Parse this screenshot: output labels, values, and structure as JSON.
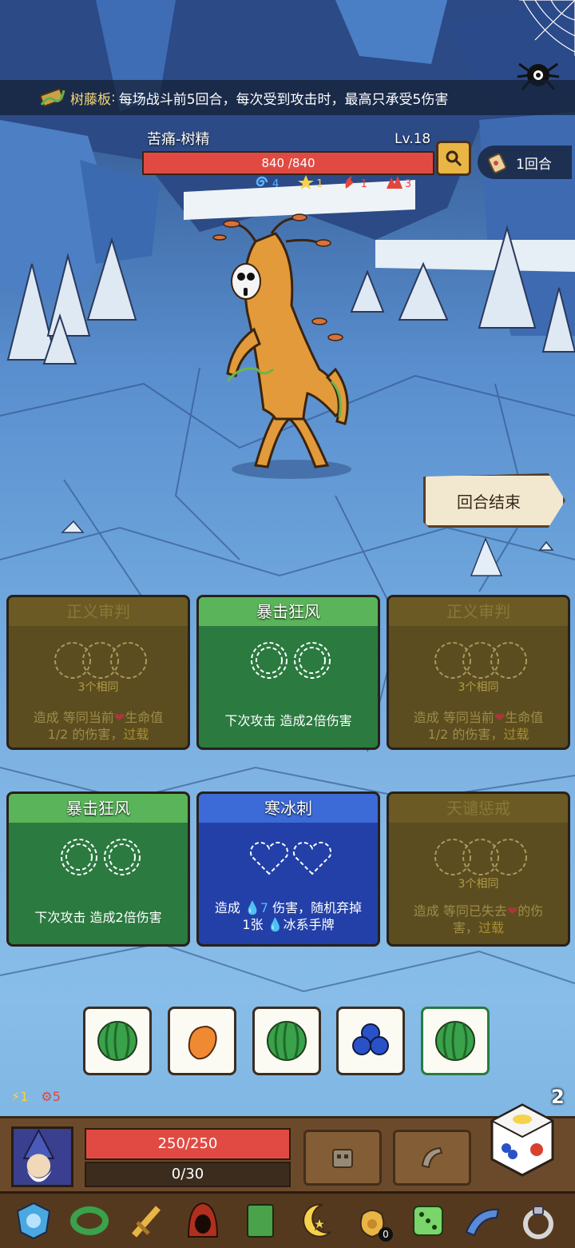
{
  "relic": {
    "name": "树藤板",
    "separator": ":",
    "description": "每场战斗前5回合，每次受到攻击时，最高只承受5伤害"
  },
  "enemy": {
    "name": "苦痛-树精",
    "level": "Lv.18",
    "hp_text": "840 /840",
    "hp_fraction": 1.0,
    "statuses": [
      {
        "icon": "spiral-icon",
        "value": "4",
        "color": "#58b6ff"
      },
      {
        "icon": "star-icon",
        "value": "1",
        "color": "#f6d24a"
      },
      {
        "icon": "claw-icon",
        "value": "1",
        "color": "#e2463b"
      },
      {
        "icon": "spike-icon",
        "value": "3",
        "color": "#e2463b"
      }
    ]
  },
  "turn": {
    "label": "1回合"
  },
  "end_turn": {
    "label": "回合结束"
  },
  "cards": [
    {
      "title": "正义审判",
      "style": "olive",
      "slots": 3,
      "slot_shape": "circle",
      "condition": "3个相同",
      "desc_a": "造成 等同当前",
      "desc_heart": "❤",
      "desc_b": "生命值",
      "desc_c": "1/2 的伤害，",
      "desc_kw": "过载"
    },
    {
      "title": "暴击狂风",
      "style": "green",
      "slots": 2,
      "slot_shape": "circle",
      "desc": "下次攻击 造成2倍伤害"
    },
    {
      "title": "正义审判",
      "style": "olive",
      "slots": 3,
      "slot_shape": "circle",
      "condition": "3个相同",
      "desc_a": "造成 等同当前",
      "desc_heart": "❤",
      "desc_b": "生命值",
      "desc_c": "1/2 的伤害，",
      "desc_kw": "过载"
    },
    {
      "title": "暴击狂风",
      "style": "green",
      "slots": 2,
      "slot_shape": "circle",
      "desc": "下次攻击 造成2倍伤害"
    },
    {
      "title": "寒冰刺",
      "style": "blue",
      "slots": 2,
      "slot_shape": "heart",
      "desc_a": "造成",
      "desc_drop": "💧7",
      "desc_b": "伤害，随机弃掉",
      "desc_c": "1张",
      "desc_drop2": "💧",
      "desc_d": "冰系手牌"
    },
    {
      "title": "天谴惩戒",
      "style": "olive",
      "slots": 3,
      "slot_shape": "circle",
      "condition": "3个相同",
      "desc_a": "造成 等同已失去",
      "desc_heart": "❤",
      "desc_b": "的伤",
      "desc_c": "害，",
      "desc_kw": "过载"
    }
  ],
  "dice": [
    {
      "face": "watermelon",
      "selected": false
    },
    {
      "face": "potato",
      "selected": false
    },
    {
      "face": "watermelon",
      "selected": false
    },
    {
      "face": "blueberry",
      "selected": false
    },
    {
      "face": "watermelon",
      "selected": true
    }
  ],
  "energy": {
    "lightning": "1",
    "gear": "5"
  },
  "player": {
    "hp_text": "250/250",
    "hp_fraction": 1.0,
    "xp_text": "0/30",
    "xp_fraction": 0.0,
    "dice_remaining": "2"
  },
  "abilities": [
    "robot-head-icon",
    "horn-icon"
  ],
  "shelf": [
    {
      "icon": "blue-shield-icon"
    },
    {
      "icon": "green-bracelet-icon"
    },
    {
      "icon": "gold-sword-icon"
    },
    {
      "icon": "red-hood-icon"
    },
    {
      "icon": "green-book-icon"
    },
    {
      "icon": "moon-star-icon"
    },
    {
      "icon": "coin-bag-icon",
      "badge": "0"
    },
    {
      "icon": "green-die-icon"
    },
    {
      "icon": "blue-horn-icon"
    },
    {
      "icon": "silver-ring-icon"
    }
  ]
}
